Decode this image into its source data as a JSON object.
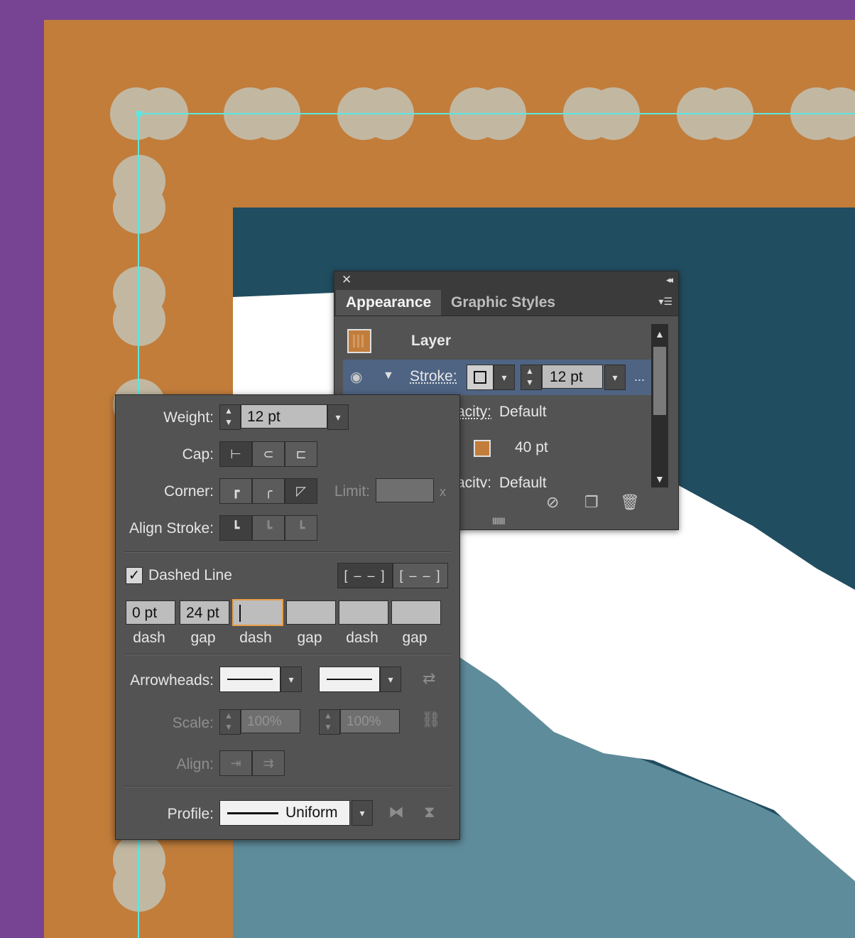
{
  "colors": {
    "background_purple": "#774493",
    "artboard_orange": "#c27d3b",
    "dark_teal": "#214d60",
    "light_teal": "#5f8c9b",
    "white": "#ffffff",
    "dash_beige": "#c2b8a2",
    "guide_cyan": "#5ae7e2",
    "accent_orange": "#f0a452",
    "selected_row": "#4f6483"
  },
  "appearance_panel": {
    "tabs": [
      {
        "label": "Appearance",
        "active": true
      },
      {
        "label": "Graphic Styles",
        "active": false
      }
    ],
    "rows": [
      {
        "label": "Layer",
        "type": "header"
      },
      {
        "label": "Stroke:",
        "weight_value": "12 pt",
        "more": "...",
        "selected": true
      },
      {
        "label": "acity:",
        "value": "Default"
      },
      {
        "label": "40 pt",
        "type": "fill_size"
      },
      {
        "label": "acity:",
        "value": "Default"
      }
    ],
    "icons": [
      "eye-icon",
      "disclosure-triangle-icon",
      "clear-appearance-icon",
      "duplicate-item-icon",
      "trash-icon"
    ]
  },
  "stroke_panel": {
    "weight_label": "Weight:",
    "weight_value": "12 pt",
    "cap_label": "Cap:",
    "corner_label": "Corner:",
    "limit_label": "Limit:",
    "limit_unit": "x",
    "align_label": "Align Stroke:",
    "dashed_label": "Dashed Line",
    "dashed_checked": true,
    "dash_fields": [
      {
        "value": "0 pt",
        "caption": "dash"
      },
      {
        "value": "24 pt",
        "caption": "gap"
      },
      {
        "value": "",
        "caption": "dash",
        "focused": true
      },
      {
        "value": "",
        "caption": "gap"
      },
      {
        "value": "",
        "caption": "dash"
      },
      {
        "value": "",
        "caption": "gap"
      }
    ],
    "arrowheads_label": "Arrowheads:",
    "scale_label": "Scale:",
    "scale_start": "100%",
    "scale_end": "100%",
    "align_arrows_label": "Align:",
    "profile_label": "Profile:",
    "profile_value": "Uniform"
  }
}
